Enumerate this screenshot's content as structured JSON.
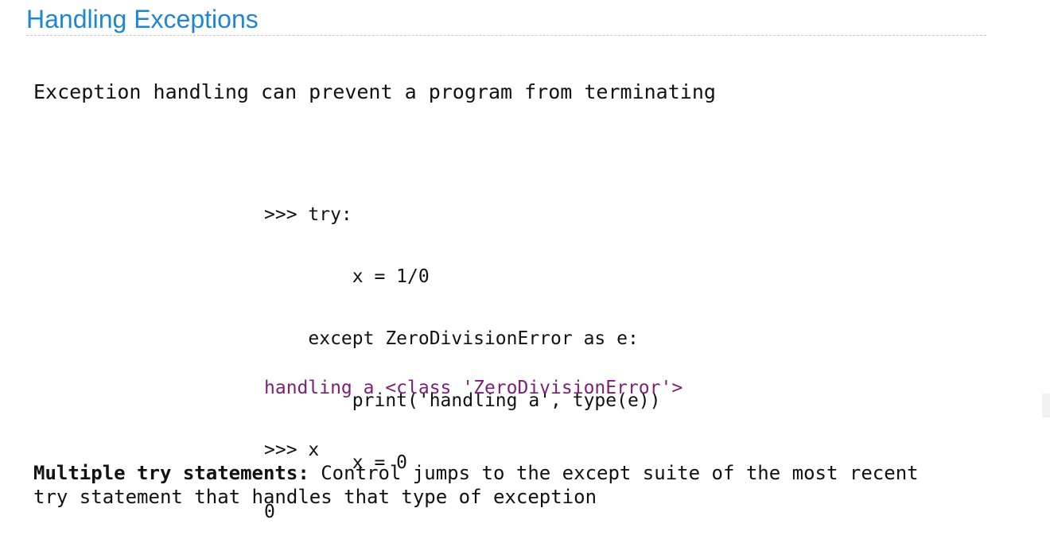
{
  "slide": {
    "title": "Handling Exceptions",
    "intro": "Exception handling can prevent a program from terminating"
  },
  "code_input": {
    "lines": [
      ">>> try:",
      "        x = 1/0",
      "    except ZeroDivisionError as e:",
      "        print('handling a', type(e))",
      "        x = 0"
    ]
  },
  "code_output": {
    "printed": "handling a <class 'ZeroDivisionError'>",
    "prompt": ">>> x",
    "result": "0"
  },
  "footer": {
    "bold": "Multiple try statements:",
    "line1_rest": " Control jumps to the except suite of the most recent",
    "line2": "try statement that handles that type of exception"
  }
}
